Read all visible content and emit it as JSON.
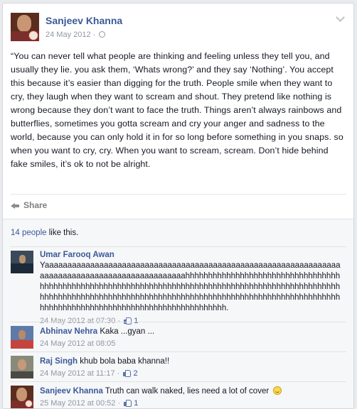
{
  "post": {
    "author": "Sanjeev Khanna",
    "date": "24 May 2012",
    "separator": "·",
    "text": "“You can never tell what people are thinking and feeling unless they tell you, and usually they lie. you ask them, ‘Whats wrong?’ and they say ‘Nothing’. You accept this because it’s easier than digging for the truth. People smile when they want to cry, they laugh when they want to scream and shout. They pretend like nothing is wrong because they don’t want to face the truth. Things aren’t always rainbows and butterflies, sometimes you gotta scream and cry your anger and sadness to the world, because you can only hold it in for so long before something in you snaps. so when you want to cry, cry. When you want to scream, scream. Don’t hide behind fake smiles, it’s ok to not be alright.",
    "share_label": "Share"
  },
  "likes": {
    "count_link": "14 people",
    "suffix": " like this."
  },
  "comments": [
    {
      "name": "Umar Farooq Awan",
      "text": "Yaaaaaaaaaaaaaaaaaaaaaaaaaaaaaaaaaaaaaaaaaaaaaaaaaaaaaaaaaaaaaaaaaaaaaaaaaaaaaaaaaaaaaaaaaaaaaaaaahhhhhhhhhhhhhhhhhhhhhhhhhhhhhhhhhhhhhhhhhhhhhhhhhhhhhhhhhhhhhhhhhhhhhhhhhhhhhhhhhhhhhhhhhhhhhhhhhhhhhhhhhhhhhhhhhhhhhhhhhhhhhhhhhhhhhhhhhhhhhhhhhhhhhhhhhhhhhhhhhhhhhhhhhhhhhhhhhhhhhhhhhhhhhhhhhhhhhhhhhhhhhhh.",
      "timestamp": "24 May 2012 at 07:30",
      "likes": "1"
    },
    {
      "name": "Abhinav Nehra",
      "text": "Kaka ...gyan ...",
      "timestamp": "24 May 2012 at 08:05",
      "likes": ""
    },
    {
      "name": "Raj Singh",
      "text": "khub bola baba khanna!!",
      "timestamp": "24 May 2012 at 11:17",
      "likes": "2"
    },
    {
      "name": "Sanjeev Khanna",
      "text": "Truth can walk naked, lies need a lot of cover",
      "timestamp": "25 May 2012 at 00:52",
      "likes": "1"
    }
  ],
  "colors": {
    "link": "#3b5998",
    "meta": "#9197a3",
    "background": "#e9ebee"
  },
  "icons": [
    "globe-icon",
    "chevron-down-icon",
    "share-icon",
    "like-icon",
    "smile-icon"
  ]
}
